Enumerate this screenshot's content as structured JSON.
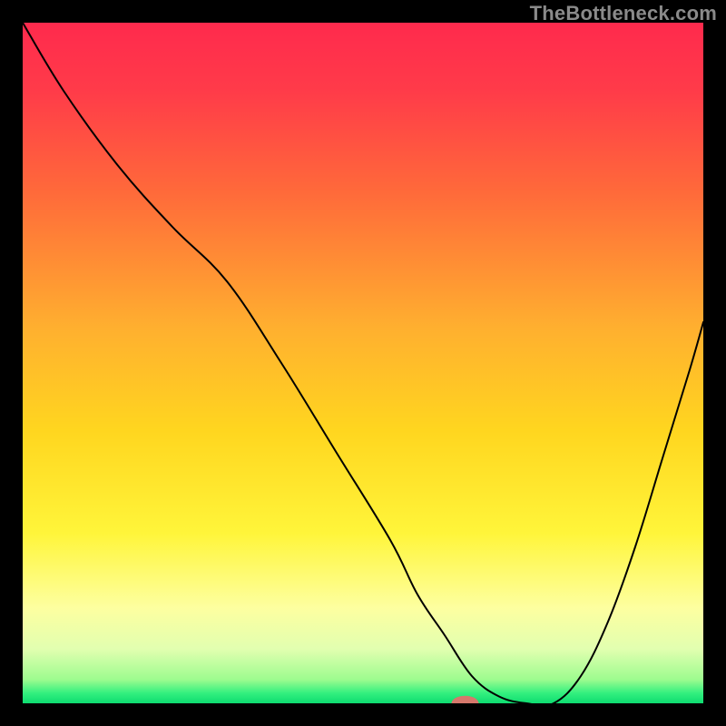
{
  "watermark": "TheBottleneck.com",
  "chart_data": {
    "type": "line",
    "title": "",
    "xlabel": "",
    "ylabel": "",
    "xlim": [
      0,
      100
    ],
    "ylim": [
      0,
      100
    ],
    "grid": false,
    "legend": false,
    "gradient_stops": [
      {
        "offset": 0.0,
        "color": "#ff2a4d"
      },
      {
        "offset": 0.1,
        "color": "#ff3b49"
      },
      {
        "offset": 0.25,
        "color": "#ff6a3a"
      },
      {
        "offset": 0.45,
        "color": "#ffb02f"
      },
      {
        "offset": 0.6,
        "color": "#ffd61f"
      },
      {
        "offset": 0.75,
        "color": "#fff53a"
      },
      {
        "offset": 0.86,
        "color": "#fdffa0"
      },
      {
        "offset": 0.92,
        "color": "#e2ffb0"
      },
      {
        "offset": 0.965,
        "color": "#9dfc8f"
      },
      {
        "offset": 0.985,
        "color": "#33f07f"
      },
      {
        "offset": 1.0,
        "color": "#0edc70"
      }
    ],
    "series": [
      {
        "name": "bottleneck-curve",
        "x": [
          0,
          6,
          14,
          22,
          30,
          38,
          46,
          54,
          58,
          62,
          66,
          70,
          74,
          78,
          82,
          86,
          90,
          94,
          98,
          100
        ],
        "values": [
          100,
          90,
          79,
          70,
          62,
          50,
          37,
          24,
          16,
          10,
          4,
          1,
          0,
          0,
          4,
          12,
          23,
          36,
          49,
          56
        ]
      }
    ],
    "marker": {
      "cx": 65,
      "cy": 0,
      "rx": 2.0,
      "ry": 1.1,
      "color": "#d6786c"
    }
  }
}
